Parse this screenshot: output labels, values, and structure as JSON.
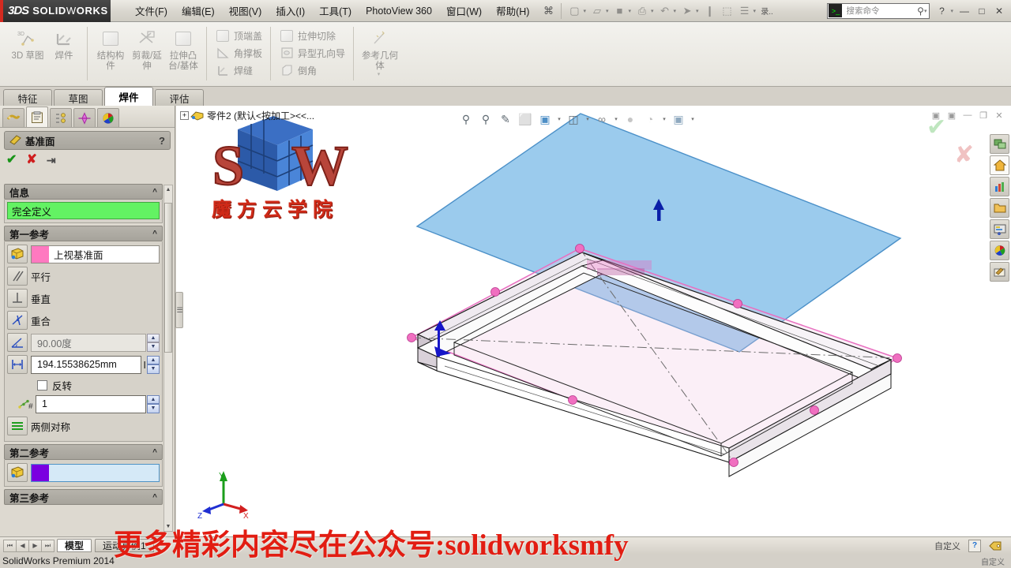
{
  "titlebar": {
    "brand_ds": "3DS",
    "brand_name_bold": "SOLID",
    "brand_name_light": "W",
    "brand_name_bold2": "ORKS",
    "menus": [
      {
        "label": "文件(F)"
      },
      {
        "label": "编辑(E)"
      },
      {
        "label": "视图(V)"
      },
      {
        "label": "插入(I)"
      },
      {
        "label": "工具(T)"
      },
      {
        "label": "PhotoView 360"
      },
      {
        "label": "窗口(W)"
      },
      {
        "label": "帮助(H)"
      }
    ],
    "quick_icons": [
      {
        "name": "flyout-pin-icon",
        "glyph": "⌘"
      },
      {
        "name": "new-document-icon",
        "glyph": "▢"
      },
      {
        "name": "open-document-icon",
        "glyph": "▱"
      },
      {
        "name": "save-icon",
        "glyph": "■"
      },
      {
        "name": "print-icon",
        "glyph": "⎙"
      },
      {
        "name": "undo-icon",
        "glyph": "↶"
      },
      {
        "name": "select-arrow-icon",
        "glyph": "➤"
      },
      {
        "name": "measure-icon",
        "glyph": "❙"
      },
      {
        "name": "appearance-icon",
        "glyph": "⬚"
      },
      {
        "name": "options-icon",
        "glyph": "☰"
      },
      {
        "name": "overflow-icon",
        "glyph": "录.."
      }
    ],
    "search_placeholder": "搜索命令",
    "help_glyph": "?",
    "window_buttons": [
      {
        "name": "minimize-window-button",
        "glyph": "—"
      },
      {
        "name": "restore-window-button",
        "glyph": "□"
      },
      {
        "name": "close-window-button",
        "glyph": "✕"
      }
    ]
  },
  "ribbon": {
    "groups": [
      {
        "kind": "big",
        "items": [
          {
            "label": "3D 草图",
            "icon": "3d-sketch-icon",
            "enabled": false
          },
          {
            "label": "焊件",
            "icon": "weldment-icon",
            "enabled": false
          }
        ]
      },
      {
        "kind": "big",
        "items": [
          {
            "label": "结构构件",
            "icon": "structural-member-icon",
            "enabled": false
          },
          {
            "label": "剪裁/延伸",
            "icon": "trim-extend-icon",
            "enabled": false
          },
          {
            "label": "拉伸凸台/基体",
            "icon": "extrude-boss-icon",
            "enabled": false
          }
        ]
      },
      {
        "kind": "small",
        "items": [
          {
            "label": "顶端盖",
            "icon": "end-cap-icon",
            "enabled": false
          },
          {
            "label": "角撑板",
            "icon": "gusset-icon",
            "enabled": false
          },
          {
            "label": "焊缝",
            "icon": "weld-bead-icon",
            "enabled": false
          }
        ]
      },
      {
        "kind": "small",
        "items": [
          {
            "label": "拉伸切除",
            "icon": "extruded-cut-icon",
            "enabled": false
          },
          {
            "label": "异型孔向导",
            "icon": "hole-wizard-icon",
            "enabled": false
          },
          {
            "label": "倒角",
            "icon": "chamfer-icon",
            "enabled": false
          }
        ]
      },
      {
        "kind": "big",
        "items": [
          {
            "label": "参考几何体",
            "icon": "reference-geometry-icon",
            "enabled": false
          }
        ]
      }
    ]
  },
  "command_tabs": [
    {
      "label": "特征",
      "active": false
    },
    {
      "label": "草图",
      "active": false
    },
    {
      "label": "焊件",
      "active": true
    },
    {
      "label": "评估",
      "active": false
    }
  ],
  "property_manager": {
    "tabs": [
      {
        "name": "feature-manager-tab",
        "icon": "feature-tree-icon",
        "selected": false
      },
      {
        "name": "property-manager-tab",
        "icon": "property-clipboard-icon",
        "selected": true
      },
      {
        "name": "configuration-manager-tab",
        "icon": "configuration-icon",
        "selected": false
      },
      {
        "name": "dimxpert-manager-tab",
        "icon": "dimxpert-icon",
        "selected": false
      },
      {
        "name": "display-manager-tab",
        "icon": "display-palette-icon",
        "selected": false
      }
    ],
    "title": "基准面",
    "help_glyph": "?",
    "actions": [
      {
        "name": "accept-button",
        "glyph": "✔"
      },
      {
        "name": "cancel-button",
        "glyph": "✘"
      },
      {
        "name": "keep-visible-button",
        "glyph": "⇥"
      }
    ],
    "sections": [
      {
        "name": "message-section",
        "title": "信息",
        "status_text": "完全定义"
      },
      {
        "name": "first-reference-section",
        "title": "第一参考",
        "reference_value": "上视基准面",
        "reference_swatch": "#ff79c0",
        "constraints": [
          {
            "label": "平行",
            "icon": "parallel-icon"
          },
          {
            "label": "垂直",
            "icon": "perpendicular-icon"
          },
          {
            "label": "重合",
            "icon": "coincident-icon"
          }
        ],
        "angle_value": "90.00度",
        "angle_icon": "angle-icon",
        "offset_value": "194.15538625mm",
        "offset_icon": "offset-distance-icon",
        "flip_label": "反转",
        "flip_checked": false,
        "count_value": "1",
        "count_icon": "number-of-planes-icon",
        "symmetry_label": "两侧对称",
        "symmetry_icon": "mid-plane-icon"
      },
      {
        "name": "second-reference-section",
        "title": "第二参考",
        "reference_value": "",
        "reference_swatch": "#7a00e0"
      },
      {
        "name": "third-reference-section",
        "title": "第三参考"
      }
    ]
  },
  "graphics": {
    "tree_item": "零件2  (默认<按加工><<...",
    "toolbar": [
      {
        "name": "zoom-to-fit-icon",
        "glyph": "⌕",
        "caret": false
      },
      {
        "name": "zoom-to-area-icon",
        "glyph": "⌕",
        "caret": false
      },
      {
        "name": "section-view-icon",
        "glyph": "✒",
        "caret": false
      },
      {
        "name": "view-orientation-icon",
        "glyph": "⬜",
        "caret": false
      },
      {
        "name": "display-style-icon",
        "glyph": "◫",
        "caret": true
      },
      {
        "name": "hide-show-items-icon",
        "glyph": "⬡",
        "caret": true
      },
      {
        "name": "edit-appearance-icon",
        "glyph": "ὓ",
        "caret": true
      },
      {
        "name": "apply-scene-icon",
        "glyph": "●",
        "caret": false
      },
      {
        "name": "view-settings-icon",
        "glyph": "◔",
        "caret": true
      },
      {
        "name": "view-display-icon",
        "glyph": "⬜",
        "caret": true
      }
    ],
    "window_buttons": [
      {
        "name": "restore-viewport-left-icon",
        "glyph": "▣"
      },
      {
        "name": "restore-viewport-right-icon",
        "glyph": "▣"
      },
      {
        "name": "minimize-viewport-button",
        "glyph": "—"
      },
      {
        "name": "restore-viewport-button",
        "glyph": "❐"
      },
      {
        "name": "close-viewport-button",
        "glyph": "✕"
      }
    ],
    "right_toolbar": [
      {
        "name": "view-palette-icon",
        "glyph": "▤"
      },
      {
        "name": "home-icon",
        "glyph": "⌂"
      },
      {
        "name": "solidworks-resources-icon",
        "glyph": "Ὄa"
      },
      {
        "name": "design-library-icon",
        "glyph": "Ὄ1"
      },
      {
        "name": "file-explorer-icon",
        "glyph": "▦"
      },
      {
        "name": "search-appearances-icon",
        "glyph": "◕"
      },
      {
        "name": "custom-properties-icon",
        "glyph": "✎"
      }
    ],
    "watermark_text": "魔方云学院",
    "watermark_logo_letters": [
      "S",
      "W"
    ],
    "ghost_ok_glyph": "✔",
    "ghost_cancel_glyph": "✘",
    "triad_axes": [
      {
        "label": "Y",
        "color": "#1b9e1b"
      },
      {
        "label": "X",
        "color": "#d21f1f"
      },
      {
        "label": "Z",
        "color": "#1f2fd2"
      }
    ],
    "plane_color": "#7fbde8",
    "plane_edge_color": "#4b90c8",
    "frame_highlight_color": "#e887c7",
    "handle_color": "#f06fc0",
    "normal_arrow_color": "#0b1fa8",
    "origin_arrow_color": "#1616c8"
  },
  "bottom": {
    "nav_buttons": [
      {
        "name": "first-config-button",
        "glyph": "⏮"
      },
      {
        "name": "prev-config-button",
        "glyph": "◀"
      },
      {
        "name": "next-config-button",
        "glyph": "▶"
      },
      {
        "name": "last-config-button",
        "glyph": "⏭"
      }
    ],
    "tabs": [
      {
        "label": "模型",
        "selected": true
      },
      {
        "label": "运动算例1",
        "selected": false
      }
    ],
    "right_items": [
      {
        "name": "units-label",
        "label": "自定义"
      },
      {
        "name": "editing-help-icon",
        "glyph": "?"
      },
      {
        "name": "tag-icon",
        "glyph": "◆"
      }
    ]
  },
  "statusbar": {
    "text": "SolidWorks Premium 2014",
    "right_text": "自定义"
  },
  "promo_overlay": {
    "text": "更多精彩内容尽在公众号:solidworksmfy",
    "color": "#e21d12"
  }
}
